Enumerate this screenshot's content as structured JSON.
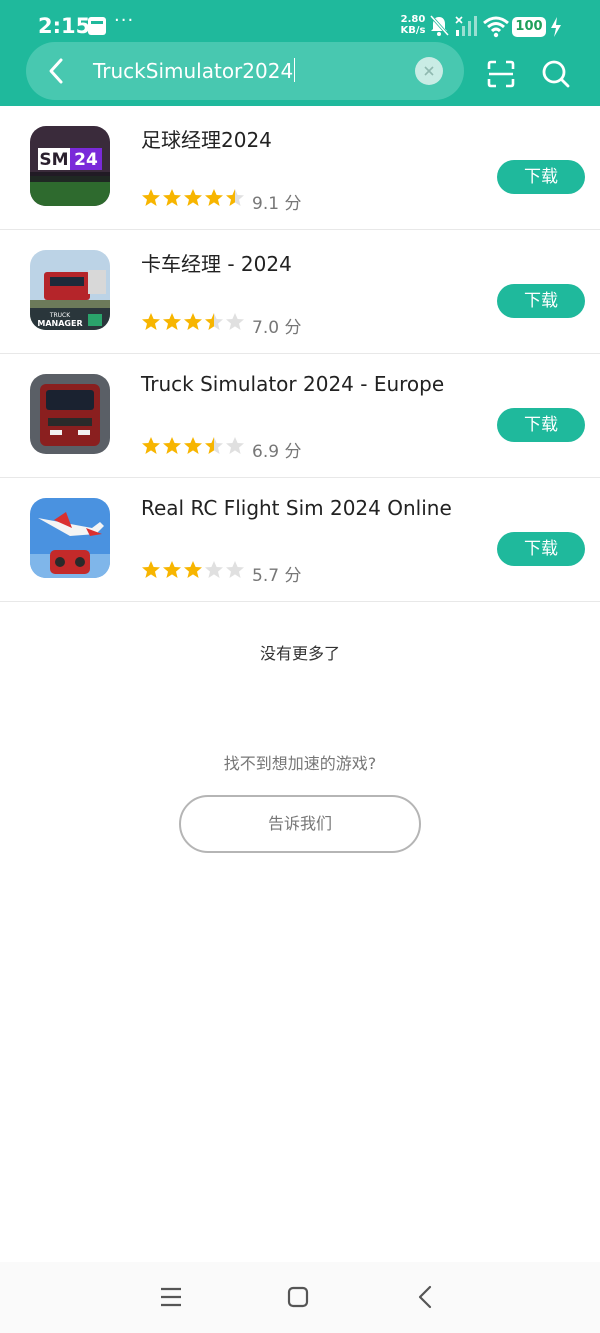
{
  "status_bar": {
    "time": "2:15",
    "more": "···",
    "net_speed_value": "2.80",
    "net_speed_unit": "KB/s",
    "battery": "100"
  },
  "search": {
    "query": "TruckSimulator2024",
    "back_icon": "back-arrow-icon",
    "clear_icon": "clear-icon",
    "scan_icon": "scan-icon",
    "search_icon": "search-icon"
  },
  "apps": [
    {
      "name": "足球经理2024",
      "rating": 4.5,
      "score": "9.1 分",
      "button": "下载",
      "icon_color": "#2a1f2e"
    },
    {
      "name": "卡车经理 - 2024",
      "rating": 3.5,
      "score": "7.0 分",
      "button": "下载",
      "icon_color": "#8a2b2b"
    },
    {
      "name": "Truck Simulator 2024 - Europe",
      "rating": 3.5,
      "score": "6.9 分",
      "button": "下载",
      "icon_color": "#5b1a1a"
    },
    {
      "name": "Real RC Flight Sim 2024 Online",
      "rating": 3,
      "score": "5.7 分",
      "button": "下载",
      "icon_color": "#2f7dd6"
    }
  ],
  "footer": {
    "no_more": "没有更多了",
    "cant_find": "找不到想加速的游戏?",
    "tell_us": "告诉我们"
  },
  "colors": {
    "accent": "#1fb99c",
    "star": "#f7b500",
    "star_empty": "#e0e0e0"
  }
}
